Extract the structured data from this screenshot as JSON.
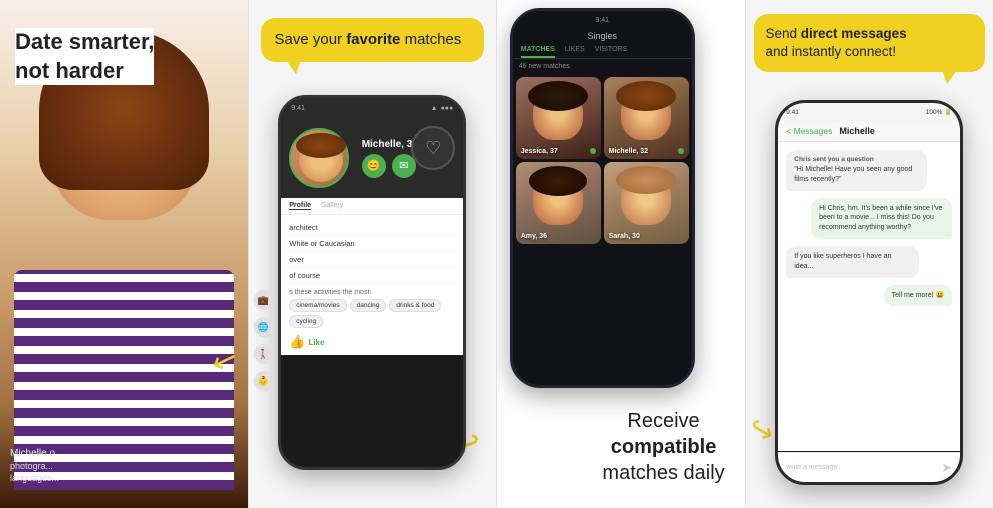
{
  "panel1": {
    "headline": "Date smarter,\nnot harder",
    "user_name": "Michelle o",
    "user_photos": "photogra...",
    "user_languages": "languages..."
  },
  "panel2": {
    "bubble_text": "Save your ",
    "bubble_bold": "favorite",
    "bubble_text2": " matches",
    "status_bar": "9:41",
    "profile_name": "Michelle, 32",
    "nav_profile": "Profile",
    "nav_gallery": "Gallery",
    "list_items": [
      "architect",
      "White or Caucasian",
      "over",
      "of course"
    ],
    "activities_label": "s these activities the most:",
    "tags": [
      "cinema/movies",
      "dancing",
      "drinks & food",
      "cycling"
    ],
    "like_btn": "Like"
  },
  "panel3": {
    "status_bar_text": "Singles",
    "tabs": [
      "MATCHES",
      "LIKES",
      "VISITORS"
    ],
    "active_tab": "MATCHES",
    "count_text": "46 new matches",
    "photos": [
      {
        "name": "Jessica, 37",
        "online": true
      },
      {
        "name": "Michelle, 32",
        "online": true
      },
      {
        "name": "Amy, 36",
        "online": false
      },
      {
        "name": "Sarah, 30",
        "online": false
      }
    ],
    "caption_line1": "Receive",
    "caption_line2": "compatible",
    "caption_line3": "matches daily"
  },
  "panel4": {
    "bubble_text": "Send ",
    "bubble_bold": "direct messages",
    "bubble_text2": "\nand instantly connect!",
    "header_back": "< Messages",
    "header_name": "Michelle",
    "messages": [
      {
        "sender": "Chris sent you a question",
        "text": "\"Hi Michelle! Have you seen any good films recently?\"",
        "type": "incoming"
      },
      {
        "text": "Hi Chris, hm. It's been a while since I've been to a movie... I miss this! Do you recommend anything worthy?",
        "type": "outgoing"
      },
      {
        "text": "If you like superheros I have an idea...",
        "type": "incoming"
      },
      {
        "text": "Tell me more! 😃",
        "type": "outgoing"
      }
    ],
    "input_placeholder": "write a message"
  },
  "colors": {
    "green": "#4CAF50",
    "yellow": "#f0d020",
    "dark": "#1a1a1a",
    "text_dark": "#222"
  }
}
